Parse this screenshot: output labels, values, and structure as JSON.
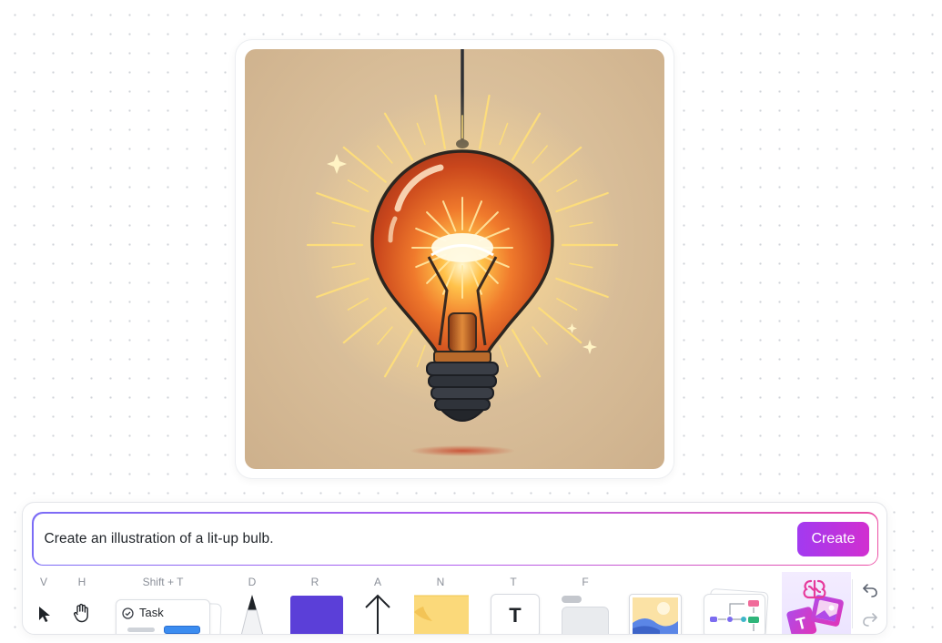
{
  "image": {
    "subject": "lit-up light bulb illustration",
    "colors": {
      "background": "#d8bd98",
      "glow": "#ffd27a",
      "glass": "#e86a2a",
      "base": "#2b2e35"
    }
  },
  "prompt": {
    "text": "Create an illustration of a lit-up bulb.",
    "create_label": "Create",
    "gradient_colors": [
      "#7b6cf6",
      "#b05cf0",
      "#ec4fa5"
    ]
  },
  "toolbar": {
    "tools": [
      {
        "name": "select",
        "shortcut": "V",
        "icon": "cursor-icon"
      },
      {
        "name": "hand",
        "shortcut": "H",
        "icon": "hand-icon"
      },
      {
        "name": "task",
        "shortcut": "Shift + T",
        "icon": "task-card-icon",
        "label": "Task"
      },
      {
        "name": "pen",
        "shortcut": "D",
        "icon": "pen-icon"
      },
      {
        "name": "rectangle",
        "shortcut": "R",
        "icon": "rectangle-icon",
        "color": "#5b3fd8"
      },
      {
        "name": "arrow",
        "shortcut": "A",
        "icon": "arrow-icon"
      },
      {
        "name": "sticky-note",
        "shortcut": "N",
        "icon": "sticky-note-icon",
        "color": "#fbd97a"
      },
      {
        "name": "text",
        "shortcut": "T",
        "icon": "text-icon",
        "glyph": "T"
      },
      {
        "name": "frame",
        "shortcut": "F",
        "icon": "frame-icon"
      },
      {
        "name": "image",
        "shortcut": "",
        "icon": "image-icon"
      },
      {
        "name": "templates",
        "shortcut": "",
        "icon": "mindmap-icon"
      },
      {
        "name": "ai",
        "shortcut": "",
        "icon": "ai-brain-icon",
        "glyph": "T"
      }
    ],
    "undo_icon": "undo-icon",
    "redo_icon": "redo-icon"
  }
}
